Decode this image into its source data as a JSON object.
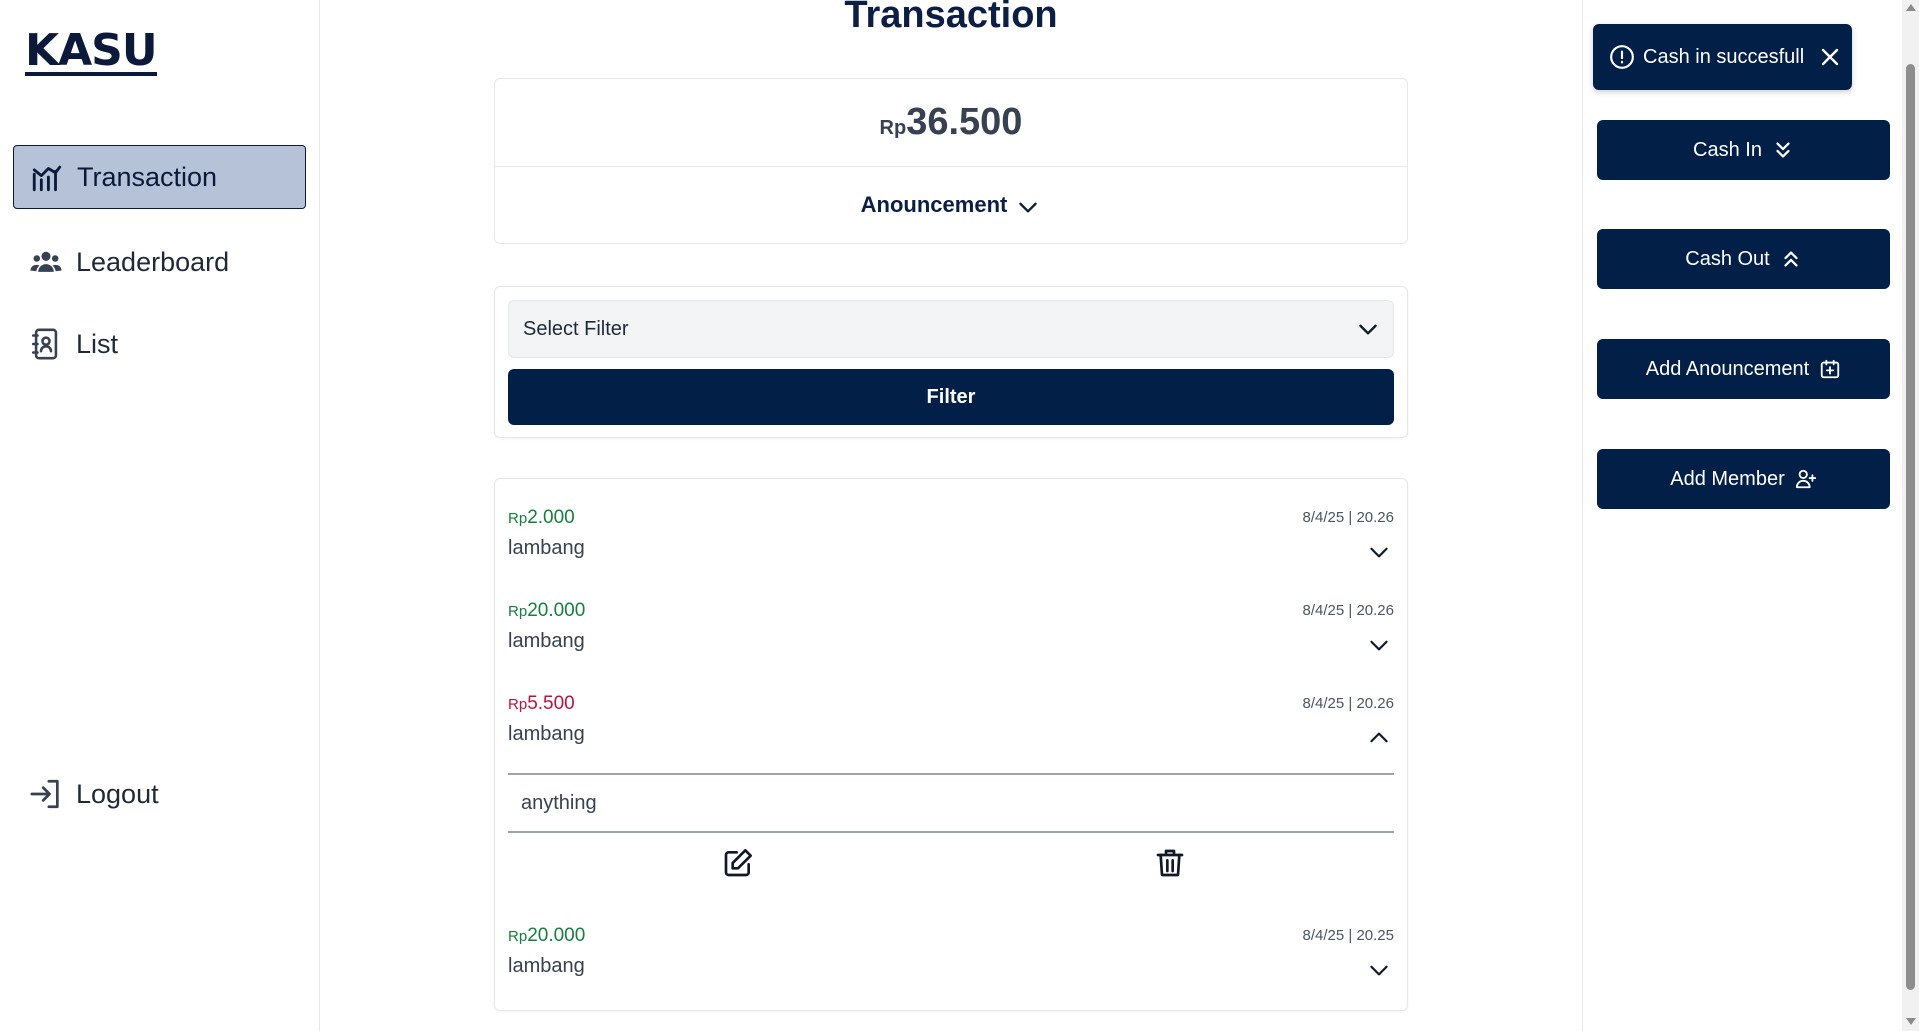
{
  "app": {
    "logo": "KASU"
  },
  "sidebar": {
    "items": [
      {
        "label": "Transaction",
        "icon": "chart-line-icon",
        "active": true
      },
      {
        "label": "Leaderboard",
        "icon": "users-icon",
        "active": false
      },
      {
        "label": "List",
        "icon": "contact-book-icon",
        "active": false
      }
    ],
    "logout": {
      "label": "Logout",
      "icon": "logout-icon"
    }
  },
  "main": {
    "title": "Transaction",
    "balance": {
      "currency": "Rp",
      "amount": "36.500"
    },
    "announcement": {
      "label": "Anouncement"
    },
    "filter": {
      "select_value": "Select Filter",
      "button_label": "Filter"
    },
    "transactions": [
      {
        "currency": "Rp",
        "amount": "2.000",
        "type": "in",
        "name": "lambang",
        "date": "8/4/25 | 20.26",
        "expanded": false
      },
      {
        "currency": "Rp",
        "amount": "20.000",
        "type": "in",
        "name": "lambang",
        "date": "8/4/25 | 20.26",
        "expanded": false
      },
      {
        "currency": "Rp",
        "amount": "5.500",
        "type": "out",
        "name": "lambang",
        "date": "8/4/25 | 20.26",
        "expanded": true,
        "note": "anything"
      },
      {
        "currency": "Rp",
        "amount": "20.000",
        "type": "in",
        "name": "lambang",
        "date": "8/4/25 | 20.25",
        "expanded": false
      }
    ]
  },
  "toast": {
    "message": "Cash in succesfull"
  },
  "actions": {
    "cash_in": "Cash In",
    "cash_out": "Cash Out",
    "add_announcement": "Add Anouncement",
    "add_member": "Add Member"
  },
  "colors": {
    "primary": "#021f47",
    "active_nav_bg": "#b6c2d8",
    "cash_in": "#15803d",
    "cash_out": "#be123c"
  }
}
